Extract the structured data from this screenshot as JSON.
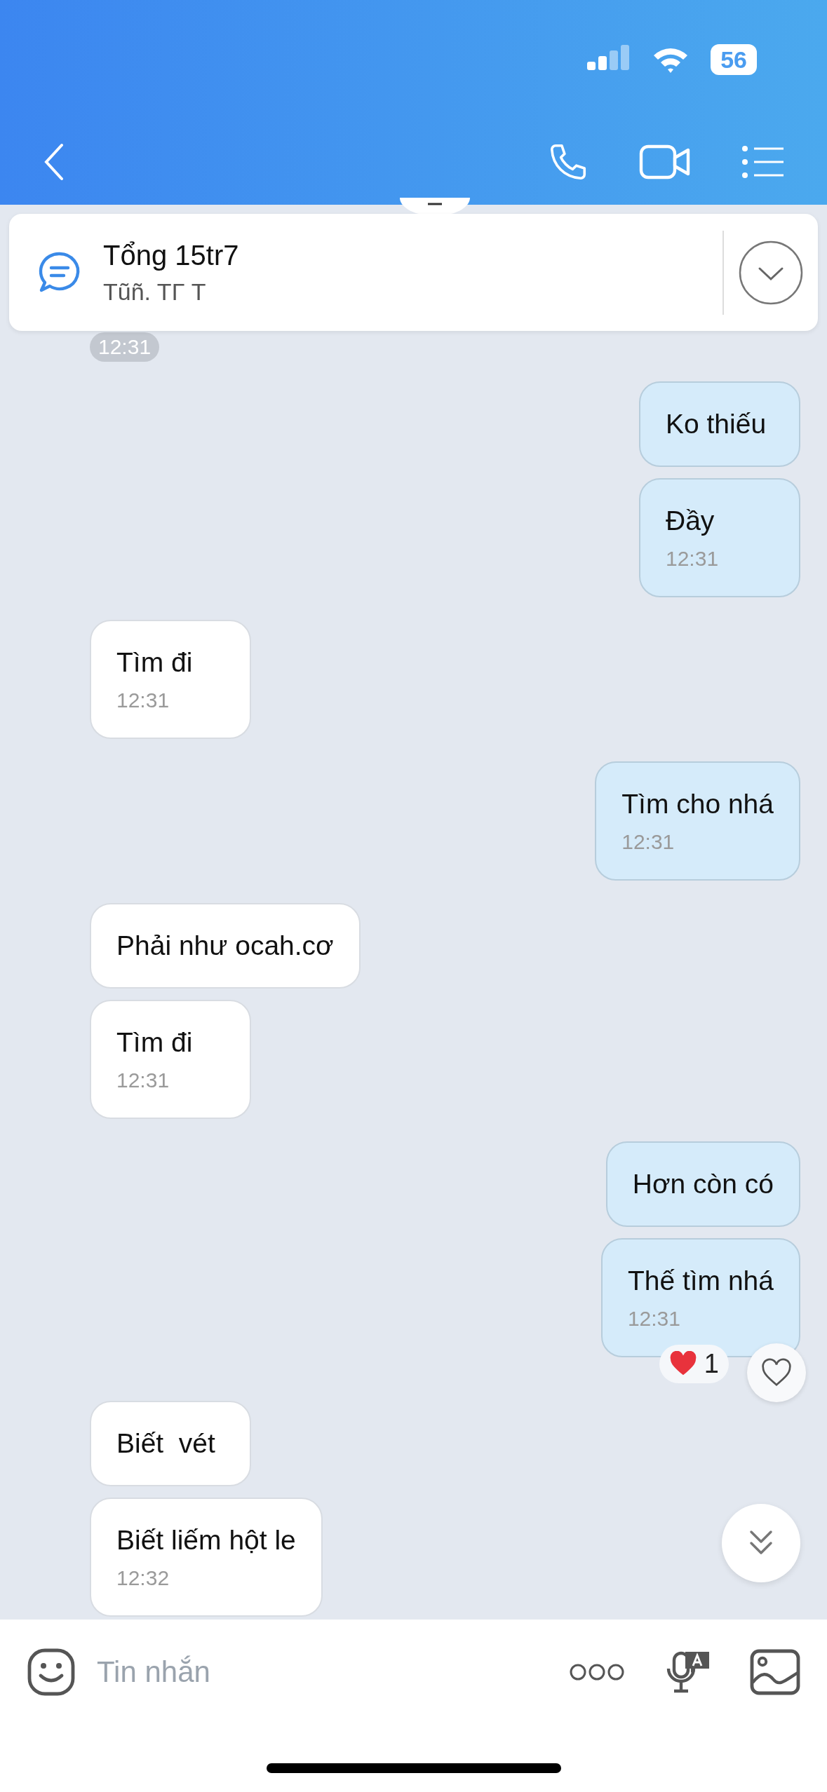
{
  "status_bar": {
    "battery": "56"
  },
  "pinned": {
    "title": "Tổng 15tr7",
    "subtitle": "Tũñ. TΓ T"
  },
  "time_badge": "12:31",
  "groups": [
    {
      "kind": "sent",
      "bubbles": [
        {
          "text": "Ko thiếu"
        },
        {
          "text": "Đầy",
          "time": "12:31"
        }
      ]
    },
    {
      "kind": "received",
      "bubbles": [
        {
          "text": "Tìm đi",
          "time": "12:31"
        }
      ]
    },
    {
      "kind": "sent",
      "bubbles": [
        {
          "text": "Tìm cho nhá",
          "time": "12:31"
        }
      ]
    },
    {
      "kind": "received",
      "bubbles": [
        {
          "text": "Phải như ocah.cơ"
        },
        {
          "text": "Tìm đi",
          "time": "12:31"
        }
      ]
    },
    {
      "kind": "sent",
      "bubbles": [
        {
          "text": "Hơn còn có"
        },
        {
          "text": "Thế tìm nhá",
          "time": "12:31",
          "reaction": {
            "count": "1"
          }
        }
      ]
    },
    {
      "kind": "received",
      "bubbles": [
        {
          "text": "Biết  vét"
        },
        {
          "text": "Biết liếm hột le",
          "time": "12:32"
        }
      ]
    }
  ],
  "composer": {
    "placeholder": "Tin nhắn"
  }
}
